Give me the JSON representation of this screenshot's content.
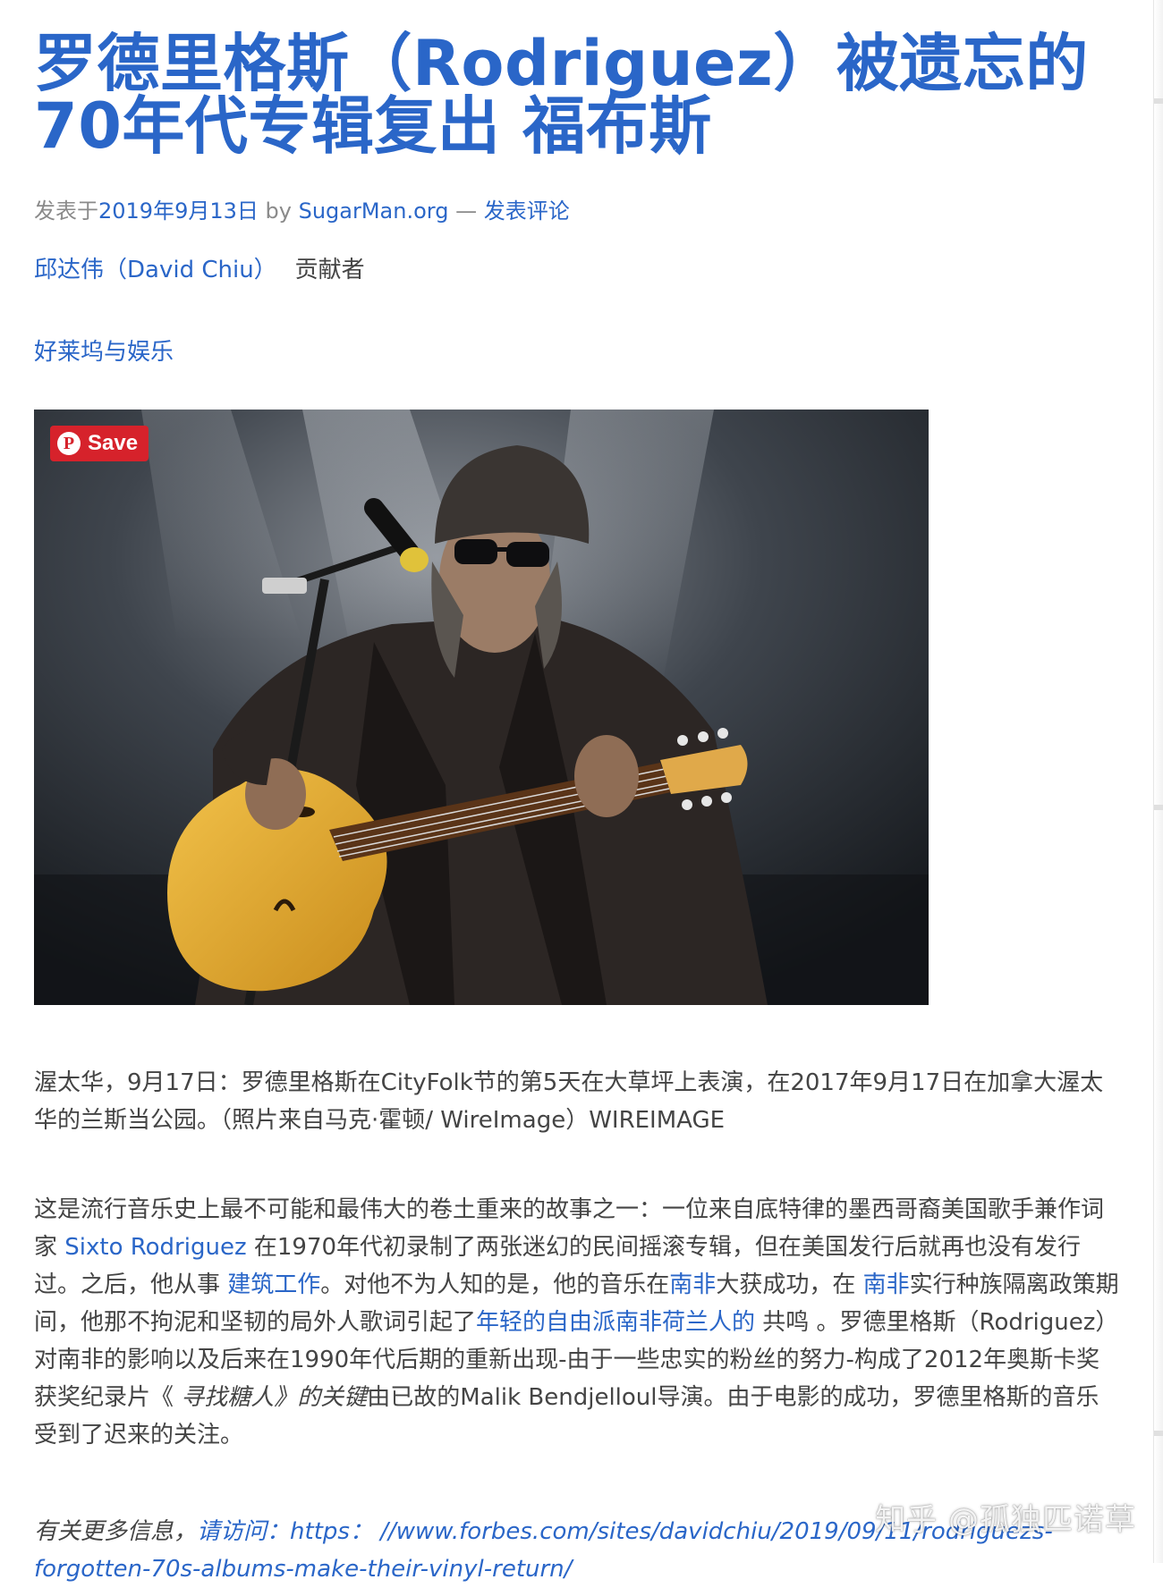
{
  "article": {
    "title_line1": "罗德里格斯（Rodriguez）被遗忘的",
    "title_line2": "70年代专辑复出 福布斯",
    "meta": {
      "posted_prefix": "发表于",
      "date": "2019年9月13日",
      "by": " by ",
      "site": "SugarMan.org",
      "sep": " — ",
      "comment_link": "发表评论"
    },
    "contributor": {
      "name": "邱达伟（David Chiu）",
      "role": "贡献者"
    },
    "category": "好莱坞与娱乐"
  },
  "photo": {
    "save_label": "Save",
    "pin_icon": "pinterest-icon"
  },
  "caption": "渥太华，9月17日：罗德里格斯在CityFolk节的第5天在大草坪上表演，在2017年9月17日在加拿大渥太华的兰斯当公园。（照片来自马克·霍顿/ WireImage）WIREIMAGE",
  "body": {
    "p1_a": "这是流行音乐史上最不可能和最伟大的卷土重来的故事之一：一位来自底特律的墨西哥裔美国歌手兼作词家 ",
    "link_sixto": "Sixto Rodriguez",
    "p1_b": " 在1970年代初录制了两张迷幻的民间摇滚专辑，但在美国发行后就再也没有发行过。之后，他从事 ",
    "link_construction": "建筑工作",
    "p1_c": "。对他不为人知的是，他的音乐在",
    "link_south_africa_1": "南非",
    "p1_d": "大获成功，在 ",
    "link_south_africa_2": "南非",
    "p1_e": "实行种族隔离政策期间，他那不拘泥和坚韧的局外人歌词引起了",
    "link_afrikaners": "年轻的自由派南非荷兰人的",
    "p1_f": " 共鸣 。罗德里格斯（Rodriguez）对南非的影响以及后来在1990年代后期的重新出现-由于一些忠实的粉丝的努力-构成了2012年奥斯卡奖获奖纪录片《 ",
    "film_italic": "寻找糖人》的关键",
    "p1_g": "由已故的Malik Bendjelloul导演。由于电影的成功，罗德里格斯的音乐受到了迟来的关注。"
  },
  "more_info": {
    "prefix": "有关更多信息，",
    "visit_link": "请访问：",
    "url": "https：  //www.forbes.com/sites/davidchiu/2019/09/11/rodriguezs-forgotten-70s-albums-make-their-vinyl-return/"
  },
  "watermark": "知乎 @孤独匹诺草"
}
